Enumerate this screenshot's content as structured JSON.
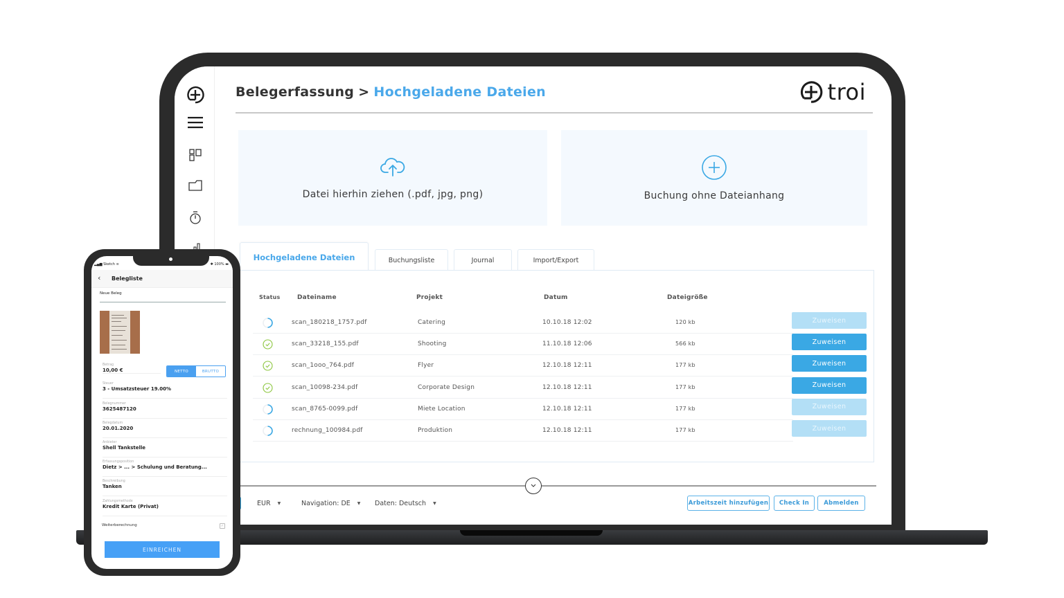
{
  "header": {
    "breadcrumb_parent": "Belegerfassung",
    "breadcrumb_separator": ">",
    "breadcrumb_current": "Hochgeladene Dateien",
    "logo_text": "troi"
  },
  "sidebar": {
    "items": [
      {
        "icon": "troi-logo-icon"
      },
      {
        "icon": "hamburger-menu-icon"
      },
      {
        "icon": "dashboard-icon"
      },
      {
        "icon": "folder-icon"
      },
      {
        "icon": "stopwatch-icon"
      },
      {
        "icon": "bar-chart-icon"
      }
    ]
  },
  "cards": {
    "upload": {
      "label": "Datei hierhin ziehen (.pdf, jpg, png)",
      "icon": "cloud-upload-icon"
    },
    "no_attachment": {
      "label": "Buchung ohne Dateianhang",
      "icon": "plus-circle-icon"
    }
  },
  "tabs": [
    {
      "label": "Hochgeladene Dateien",
      "active": true
    },
    {
      "label": "Buchungsliste",
      "active": false
    },
    {
      "label": "Journal",
      "active": false
    },
    {
      "label": "Import/Export",
      "active": false
    }
  ],
  "table": {
    "columns": [
      "Status",
      "Dateiname",
      "Projekt",
      "Datum",
      "Dateigröße"
    ],
    "rows": [
      {
        "status": "loading",
        "filename": "scan_180218_1757.pdf",
        "project": "Catering",
        "date": "10.10.18 12:02",
        "size": "120 kb",
        "action": "Zuweisen",
        "enabled": false
      },
      {
        "status": "done",
        "filename": "scan_33218_155.pdf",
        "project": "Shooting",
        "date": "11.10.18 12:06",
        "size": "566 kb",
        "action": "Zuweisen",
        "enabled": true
      },
      {
        "status": "done",
        "filename": "scan_1ooo_764.pdf",
        "project": "Flyer",
        "date": "12.10.18 12:11",
        "size": "177 kb",
        "action": "Zuweisen",
        "enabled": true
      },
      {
        "status": "done",
        "filename": "scan_10098-234.pdf",
        "project": "Corporate Design",
        "date": "12.10.18 12:11",
        "size": "177 kb",
        "action": "Zuweisen",
        "enabled": true
      },
      {
        "status": "loading",
        "filename": "scan_8765-0099.pdf",
        "project": "Miete Location",
        "date": "12.10.18 12:11",
        "size": "177 kb",
        "action": "Zuweisen",
        "enabled": false
      },
      {
        "status": "loading",
        "filename": "rechnung_100984.pdf",
        "project": "Produktion",
        "date": "12.10.18 12:11",
        "size": "177 kb",
        "action": "Zuweisen",
        "enabled": false
      }
    ]
  },
  "footer": {
    "currency": "EUR",
    "navigation_lang": "Navigation: DE",
    "data_lang": "Daten: Deutsch",
    "buttons": {
      "add_worktime": "Arbeitszeit hinzufügen",
      "check_in": "Check In",
      "logout": "Abmelden"
    }
  },
  "phone": {
    "status_left": "Sketch",
    "status_right": "100%",
    "nav_title": "Belegliste",
    "section_title": "Neue Beleg",
    "amount": {
      "label": "Betrag",
      "value": "10,00 €"
    },
    "toggle": {
      "netto": "NETTO",
      "brutto": "BRUTTO",
      "selected": "NETTO"
    },
    "fields": [
      {
        "label": "Steuer",
        "value": "3 - Umsatzsteuer 19.00%"
      },
      {
        "label": "Belegnummer",
        "value": "3625487120"
      },
      {
        "label": "Belegdatum",
        "value": "20.01.2020"
      },
      {
        "label": "Anbieter",
        "value": "Shell Tankstelle"
      },
      {
        "label": "Erfassungsposition",
        "value": "Dietz >  ...  >  Schulung und Beratung..."
      },
      {
        "label": "Beschreibung",
        "value": "Tanken"
      },
      {
        "label": "Zahlungsmethode",
        "value": "Kredit Karte (Privat)"
      }
    ],
    "weiterberechnung_label": "Weiterberechnung",
    "weiterberechnung_checked": true,
    "submit_label": "EINREICHEN"
  },
  "colors": {
    "accent": "#4aa8ea",
    "button_active": "#3aa8e4",
    "button_disabled": "#b3dff6",
    "status_done": "#8cc63f",
    "card_bg": "#f4f9fe",
    "device_frame": "#2b2b2b"
  }
}
